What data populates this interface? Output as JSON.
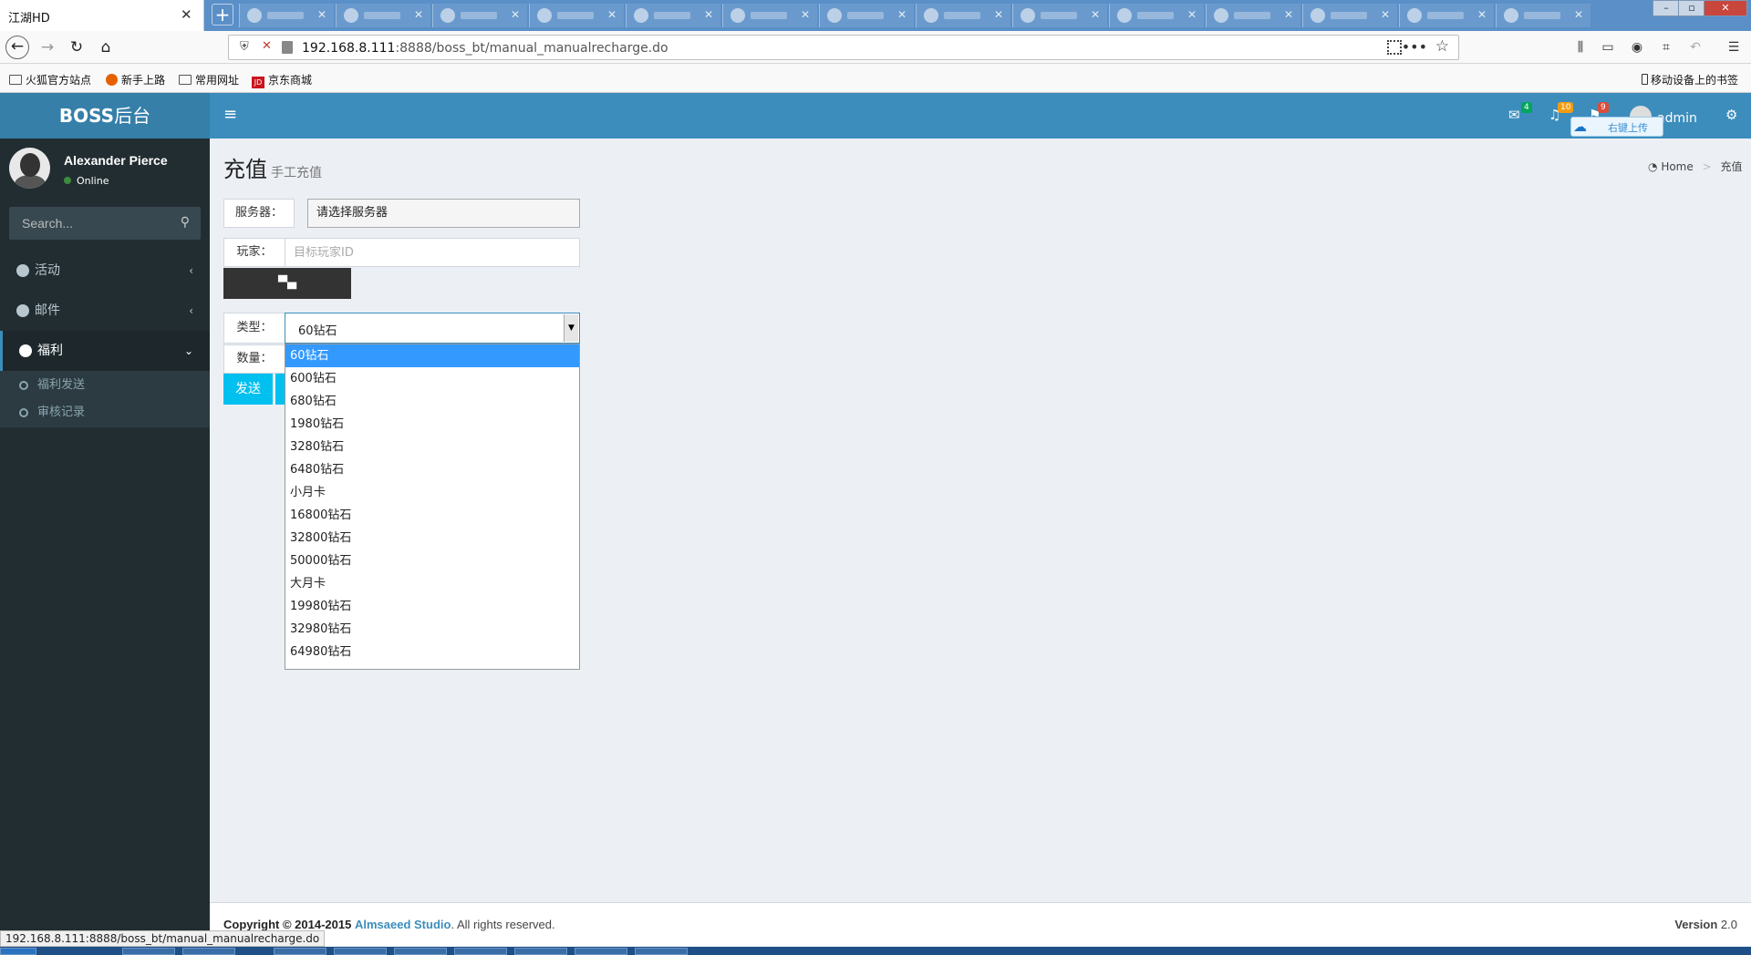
{
  "browser": {
    "active_tab_title": "江湖HD",
    "tab_close": "✕",
    "new_tab": "+",
    "url_host": "192.168.8.111",
    "url_rest": ":8888/boss_bt/manual_manualrecharge.do",
    "status_url": "192.168.8.111:8888/boss_bt/manual_manualrecharge.do",
    "bookmarks": [
      "火狐官方站点",
      "新手上路",
      "常用网址",
      "京东商城"
    ],
    "mobile_bookmarks": "移动设备上的书签"
  },
  "app": {
    "logo_bold": "BOSS",
    "logo_rest": "后台",
    "user_name": "Alexander Pierce",
    "user_status": "Online",
    "search_placeholder": "Search...",
    "top_user": "admin",
    "badges": {
      "messages": "4",
      "notifications": "10",
      "tasks": "9"
    },
    "float_label": "右键上传"
  },
  "sidebar": {
    "items": [
      {
        "label": "活动",
        "chevron": "‹"
      },
      {
        "label": "邮件",
        "chevron": "‹"
      },
      {
        "label": "福利",
        "chevron": "⌄"
      }
    ],
    "submenu": [
      "福利发送",
      "审核记录"
    ]
  },
  "page": {
    "title": "充值",
    "subtitle": "手工充值",
    "breadcrumb_home": "Home",
    "breadcrumb_current": "充值"
  },
  "form": {
    "server_label": "服务器：",
    "server_value": "请选择服务器",
    "player_label": "玩家：",
    "player_placeholder": "目标玩家ID",
    "type_label": "类型：",
    "type_selected": "60钻石",
    "quantity_label": "数量：",
    "send_label": "发送",
    "type_options": [
      "60钻石",
      "600钻石",
      "680钻石",
      "1980钻石",
      "3280钻石",
      "6480钻石",
      "小月卡",
      "16800钻石",
      "32800钻石",
      "50000钻石",
      "大月卡",
      "19980钻石",
      "32980钻石",
      "64980钻石"
    ]
  },
  "footer": {
    "copyright": "Copyright © 2014-2015",
    "studio": "Almsaeed Studio",
    "rights": ". All rights reserved.",
    "version_label": "Version",
    "version": "2.0"
  },
  "colors": {
    "header_blue": "#3c8dbc",
    "logo_blue": "#367fa9",
    "sidebar_dark": "#222d32",
    "send_cyan": "#00c0ef",
    "option_highlight": "#3399ff"
  }
}
